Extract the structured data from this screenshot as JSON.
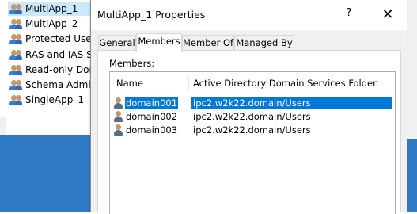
{
  "background_list": {
    "items": [
      {
        "label": "MultiApp_1",
        "selected": true
      },
      {
        "label": "MultiApp_2",
        "selected": false
      },
      {
        "label": "Protected Users",
        "selected": false
      },
      {
        "label": "RAS and IAS Ser",
        "selected": false
      },
      {
        "label": "Read-only Dom",
        "selected": false
      },
      {
        "label": "Schema Admins",
        "selected": false
      },
      {
        "label": "SingleApp_1",
        "selected": false
      }
    ]
  },
  "dialog": {
    "title": "MultiApp_1 Properties",
    "help_label": "?",
    "close_label": "✕",
    "tabs": [
      {
        "label": "General",
        "active": false
      },
      {
        "label": "Members",
        "active": true
      },
      {
        "label": "Member Of",
        "active": false
      },
      {
        "label": "Managed By",
        "active": false
      }
    ],
    "members_label": "Members:",
    "columns": {
      "name": "Name",
      "folder": "Active Directory Domain Services Folder"
    },
    "members": [
      {
        "name": "domain001",
        "folder": "ipc2.w2k22.domain/Users",
        "selected": true
      },
      {
        "name": "domain002",
        "folder": "ipc2.w2k22.domain/Users",
        "selected": false
      },
      {
        "name": "domain003",
        "folder": "ipc2.w2k22.domain/Users",
        "selected": false
      }
    ]
  },
  "colors": {
    "selection": "#0078d7",
    "tree_selection": "#cce8ff",
    "desktop_blue": "#2e78c4"
  }
}
